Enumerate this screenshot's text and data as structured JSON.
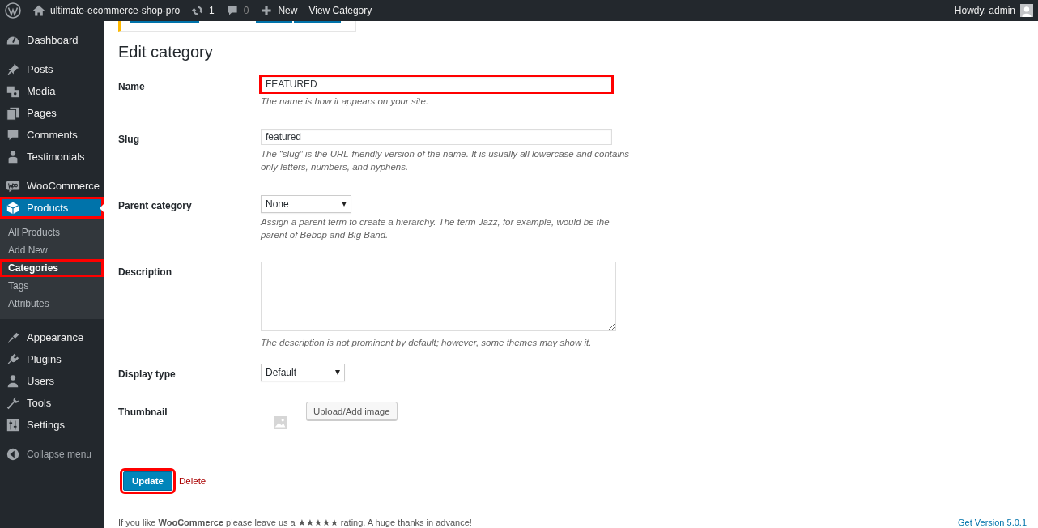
{
  "admin_bar": {
    "site_name": "ultimate-ecommerce-shop-pro",
    "updates": "1",
    "comments": "0",
    "new_label": "New",
    "view_label": "View Category",
    "greeting": "Howdy, admin"
  },
  "sidebar": {
    "groups": [
      {
        "items": [
          {
            "label": "Dashboard",
            "selected": false
          }
        ]
      },
      {
        "items": [
          {
            "label": "Posts",
            "selected": false
          },
          {
            "label": "Media",
            "selected": false
          },
          {
            "label": "Pages",
            "selected": false
          },
          {
            "label": "Comments",
            "selected": false
          },
          {
            "label": "Testimonials",
            "selected": false
          }
        ]
      },
      {
        "items": [
          {
            "label": "WooCommerce",
            "selected": false
          },
          {
            "label": "Products",
            "selected": true,
            "highlighted": true,
            "children": [
              {
                "label": "All Products",
                "selected": false,
                "highlighted": false
              },
              {
                "label": "Add New",
                "selected": false,
                "highlighted": false
              },
              {
                "label": "Categories",
                "selected": true,
                "highlighted": true
              },
              {
                "label": "Tags",
                "selected": false,
                "highlighted": false
              },
              {
                "label": "Attributes",
                "selected": false,
                "highlighted": false
              }
            ]
          }
        ]
      },
      {
        "items": [
          {
            "label": "Appearance",
            "selected": false
          },
          {
            "label": "Plugins",
            "selected": false
          },
          {
            "label": "Users",
            "selected": false
          },
          {
            "label": "Tools",
            "selected": false
          },
          {
            "label": "Settings",
            "selected": false
          }
        ]
      }
    ],
    "collapse_label": "Collapse menu"
  },
  "heading": "Edit category",
  "form": {
    "rows": [
      {
        "kind": "text",
        "label": "Name",
        "value": "FEATURED",
        "highlighted": true,
        "help": "The name is how it appears on your site."
      },
      {
        "kind": "text",
        "label": "Slug",
        "value": "featured",
        "highlighted": false,
        "help": "The “slug” is the URL-friendly version of the name. It is usually all lowercase and contains only letters, numbers, and hyphens."
      },
      {
        "kind": "select",
        "label": "Parent category",
        "value": "None",
        "help": "Assign a parent term to create a hierarchy. The term Jazz, for example, would be the parent of Bebop and Big Band."
      },
      {
        "kind": "textarea",
        "label": "Description",
        "value": "",
        "help": "The description is not prominent by default; however, some themes may show it."
      },
      {
        "kind": "select",
        "label": "Display type",
        "value": "Default"
      },
      {
        "kind": "thumbnail",
        "label": "Thumbnail",
        "button": "Upload/Add image"
      }
    ]
  },
  "actions": {
    "update": "Update",
    "update_highlighted": true,
    "delete": "Delete"
  },
  "footer": {
    "thanks": "If you like **WooCommerce** please leave us a ★★★★★ rating. A huge thanks in advance!",
    "version": "Get Version 5.0.1"
  }
}
